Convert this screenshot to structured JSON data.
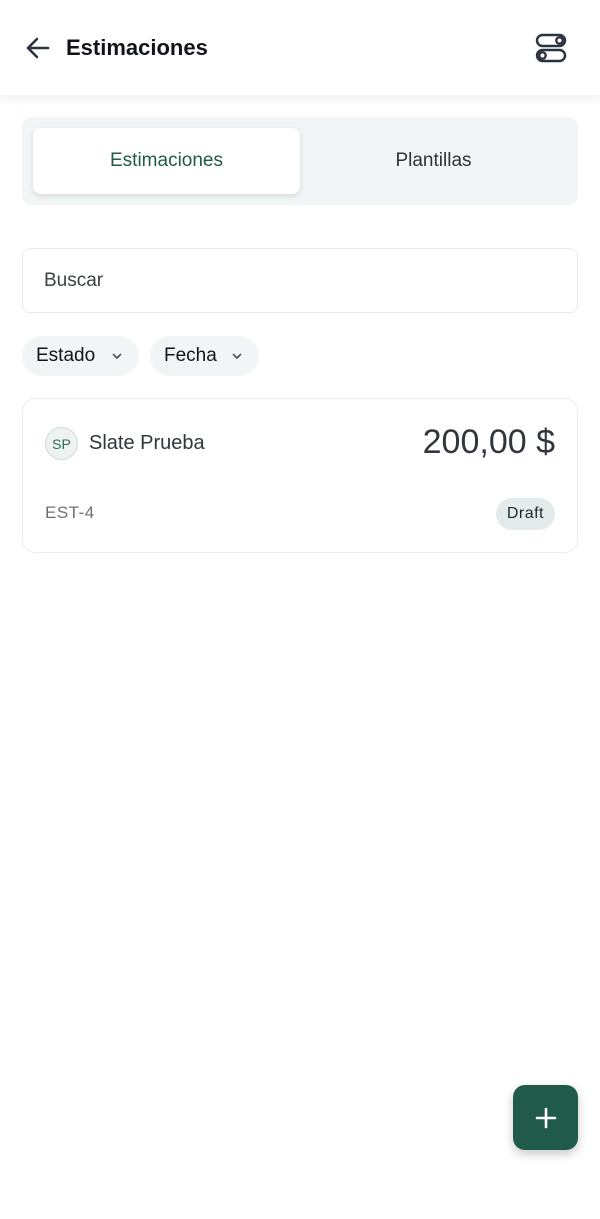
{
  "header": {
    "title": "Estimaciones",
    "back_icon": "arrow-left-icon",
    "settings_icon": "toggles-icon"
  },
  "tabs": [
    {
      "label": "Estimaciones",
      "active": true
    },
    {
      "label": "Plantillas",
      "active": false
    }
  ],
  "search": {
    "placeholder": "Buscar",
    "value": ""
  },
  "filters": [
    {
      "label": "Estado",
      "icon": "chevron-down-icon"
    },
    {
      "label": "Fecha",
      "icon": "chevron-down-icon"
    }
  ],
  "estimates": [
    {
      "initials": "SP",
      "customer": "Slate Prueba",
      "amount": "200,00 $",
      "number": "EST-4",
      "status": "Draft"
    }
  ],
  "fab": {
    "icon": "plus-icon"
  },
  "colors": {
    "accent": "#1f5a4b",
    "tab_background": "#f1f5f5",
    "badge_background": "#e3ecea"
  }
}
